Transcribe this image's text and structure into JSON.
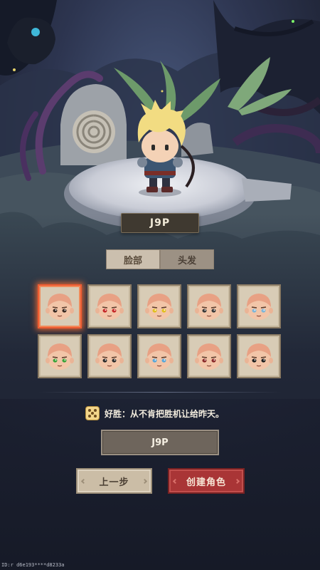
{
  "character": {
    "name_plate": "J9P"
  },
  "tabs": [
    {
      "label": "脸部",
      "active": true
    },
    {
      "label": "头发",
      "active": false
    }
  ],
  "faces": {
    "selected_index": 0,
    "items": [
      {
        "name": "face-1",
        "eye_color": "#3a2a22"
      },
      {
        "name": "face-2",
        "eye_color": "#c62a2a"
      },
      {
        "name": "face-3",
        "eye_color": "#e2c021"
      },
      {
        "name": "face-4",
        "eye_color": "#3a3a3a"
      },
      {
        "name": "face-5",
        "eye_color": "#7fb6d8"
      },
      {
        "name": "face-6",
        "eye_color": "#3aa33a"
      },
      {
        "name": "face-7",
        "eye_color": "#2c2c2c"
      },
      {
        "name": "face-8",
        "eye_color": "#5aa7d8"
      },
      {
        "name": "face-9",
        "eye_color": "#8a2a2a"
      },
      {
        "name": "face-10",
        "eye_color": "#1f1f1f"
      }
    ]
  },
  "trait": {
    "text": "好胜：从不肯把胜机让给昨天。",
    "icon": "dice-icon"
  },
  "name_input": {
    "value": "J9P"
  },
  "buttons": {
    "prev": "上一步",
    "create": "创建角色"
  },
  "footer": {
    "id_text": "ID:r d6e193****d8233a"
  },
  "colors": {
    "selected_outline": "#ee5c32",
    "create_button": "#a93536",
    "prev_button": "#cbbda6"
  }
}
